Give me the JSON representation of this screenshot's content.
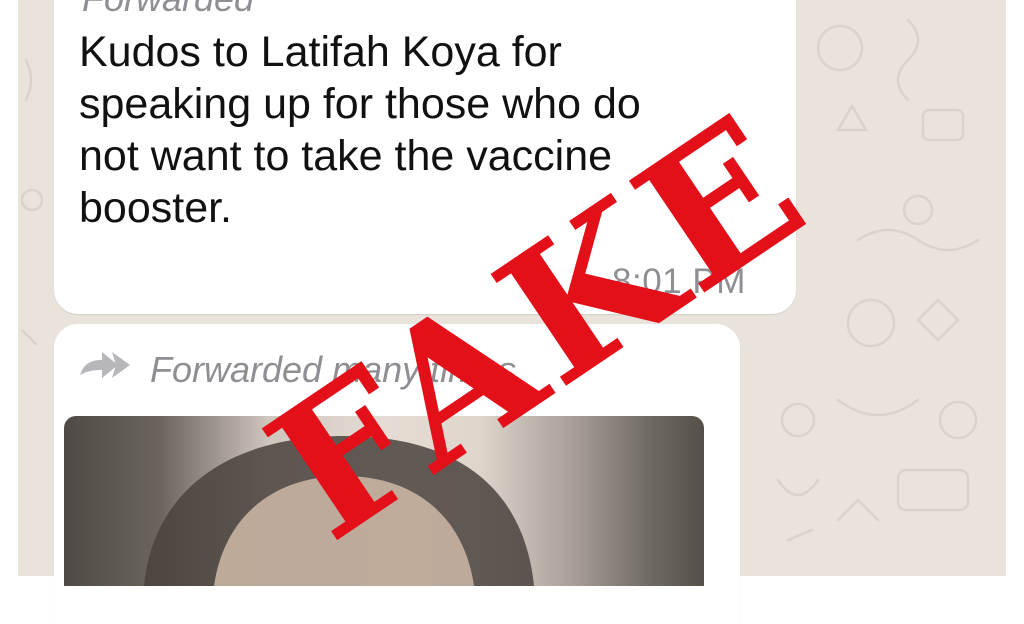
{
  "chat": {
    "forwarded_label_top": "Forwarded",
    "message_text": "Kudos to Latifah Koya for\nspeaking up for those who do\nnot want to take the vaccine\nbooster.",
    "timestamp": "8:01 PM",
    "forwarded_many_label": "Forwarded many times"
  },
  "stamp": {
    "text": "FAKE",
    "color": "#e3101a"
  },
  "colors": {
    "chat_background": "#e9e3dc",
    "bubble": "#ffffff",
    "meta_text": "#8e8e93"
  }
}
